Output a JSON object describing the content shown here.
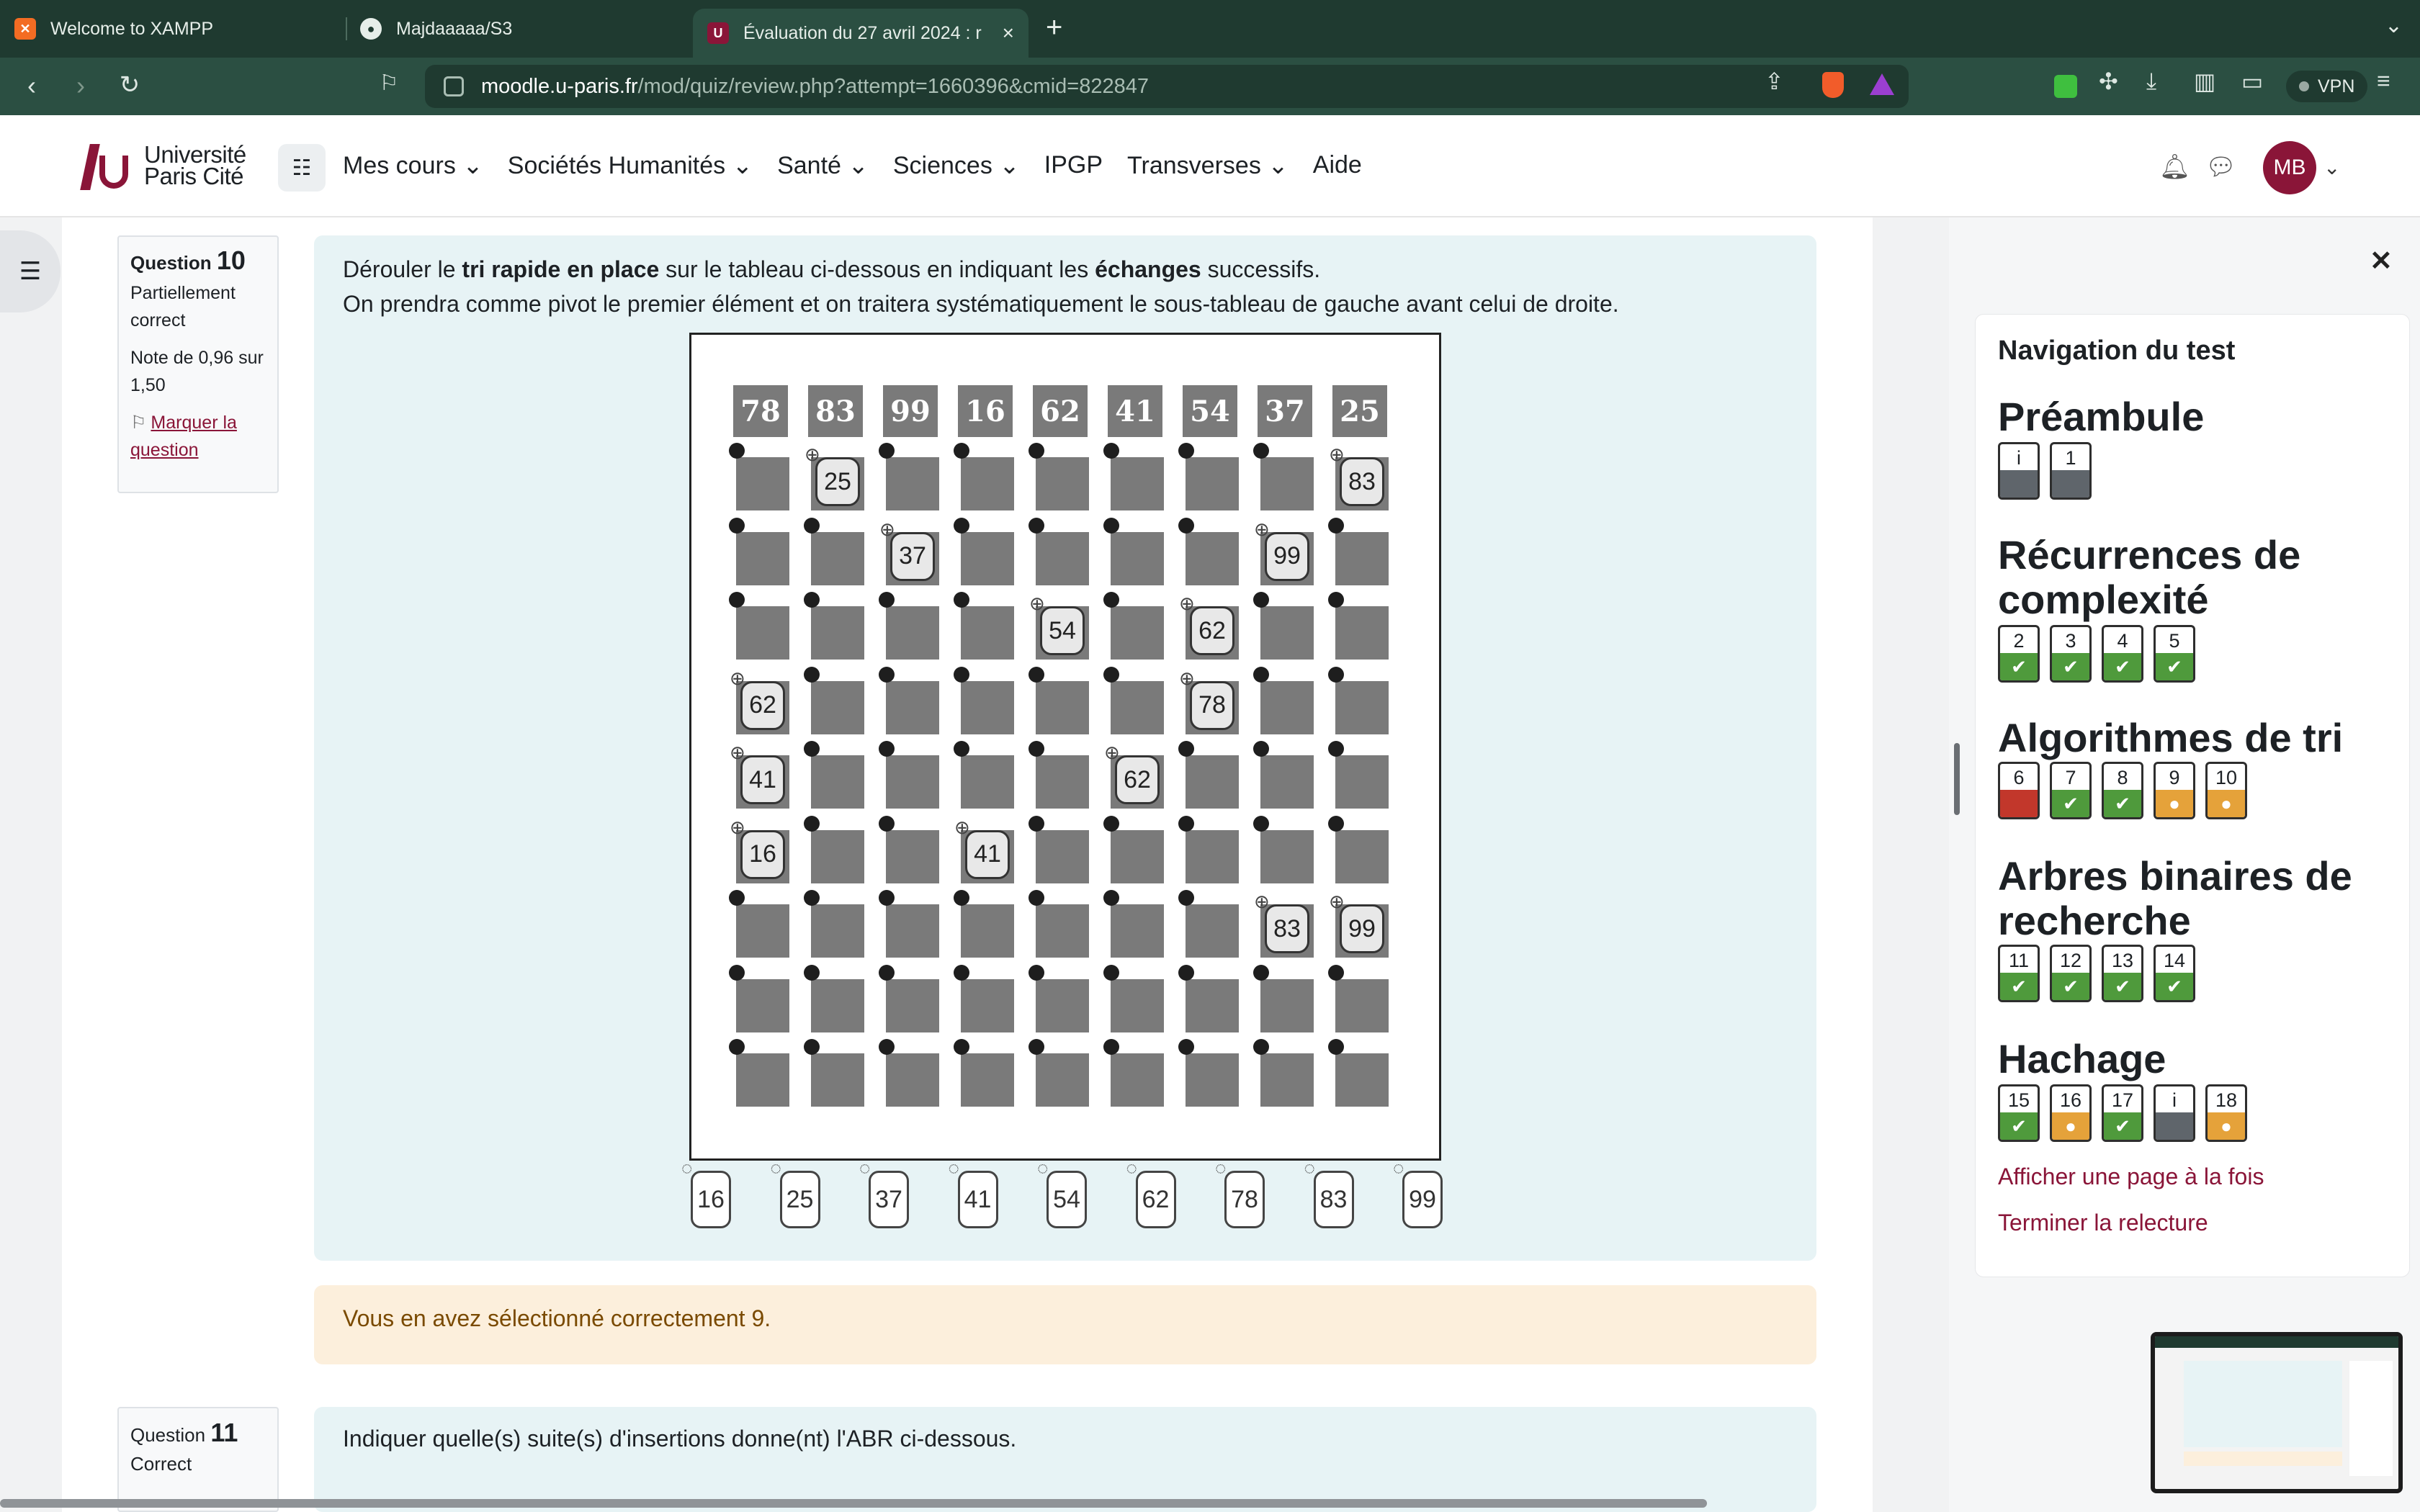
{
  "browser": {
    "tabs": [
      {
        "title": "Welcome to XAMPP",
        "icon": "xampp-icon"
      },
      {
        "title": "Majdaaaaa/S3",
        "icon": "github-icon"
      },
      {
        "title": "Évaluation du 27 avril 2024 : r",
        "icon": "moodle-icon",
        "active": true
      }
    ],
    "url_host": "moodle.u-paris.fr",
    "url_path": "/mod/quiz/review.php?attempt=1660396&cmid=822847",
    "vpn_label": "VPN"
  },
  "site": {
    "logo_line1": "Université",
    "logo_line2": "Paris Cité",
    "menu": [
      "Mes cours",
      "Sociétés Humanités",
      "Santé",
      "Sciences",
      "IPGP",
      "Transverses",
      "Aide"
    ],
    "menu_has_caret": [
      true,
      true,
      true,
      true,
      false,
      true,
      false
    ],
    "user_initials": "MB",
    "brand_color": "#8a1538"
  },
  "question10": {
    "label": "Question",
    "number": "10",
    "state": "Partiellement correct",
    "grade": "Note de 0,96 sur 1,50",
    "flag": "Marquer la question",
    "prompt1_pre": "Dérouler le ",
    "prompt1_b1": "tri rapide en place",
    "prompt1_mid": " sur le tableau ci-dessous en indiquant les ",
    "prompt1_b2": "échanges",
    "prompt1_post": " successifs.",
    "prompt2": "On prendra comme pivot le premier élément et on traitera systématiquement le sous-tableau de gauche avant celui de droite.",
    "header": [
      "78",
      "83",
      "99",
      "16",
      "62",
      "41",
      "54",
      "37",
      "25"
    ],
    "rows": 9,
    "placements": [
      {
        "row": 0,
        "col": 1,
        "value": "25"
      },
      {
        "row": 0,
        "col": 8,
        "value": "83"
      },
      {
        "row": 1,
        "col": 2,
        "value": "37"
      },
      {
        "row": 1,
        "col": 7,
        "value": "99"
      },
      {
        "row": 2,
        "col": 4,
        "value": "54"
      },
      {
        "row": 2,
        "col": 6,
        "value": "62"
      },
      {
        "row": 3,
        "col": 0,
        "value": "62"
      },
      {
        "row": 3,
        "col": 6,
        "value": "78"
      },
      {
        "row": 4,
        "col": 0,
        "value": "41"
      },
      {
        "row": 4,
        "col": 5,
        "value": "62"
      },
      {
        "row": 5,
        "col": 0,
        "value": "16"
      },
      {
        "row": 5,
        "col": 3,
        "value": "41"
      },
      {
        "row": 6,
        "col": 7,
        "value": "83"
      },
      {
        "row": 6,
        "col": 8,
        "value": "99"
      }
    ],
    "choices": [
      "16",
      "25",
      "37",
      "41",
      "54",
      "62",
      "78",
      "83",
      "99"
    ],
    "feedback": "Vous en avez sélectionné correctement 9."
  },
  "question11": {
    "label": "Question",
    "number": "11",
    "state": "Correct",
    "prompt": "Indiquer quelle(s) suite(s) d'insertions donne(nt) l'ABR ci-dessous."
  },
  "quiz_nav": {
    "title": "Navigation du test",
    "sections": [
      {
        "name": "Préambule",
        "buttons": [
          {
            "label": "i",
            "status": "info"
          },
          {
            "label": "1",
            "status": "info"
          }
        ]
      },
      {
        "name": "Récurrences de complexité",
        "buttons": [
          {
            "label": "2",
            "status": "correct"
          },
          {
            "label": "3",
            "status": "correct"
          },
          {
            "label": "4",
            "status": "correct"
          },
          {
            "label": "5",
            "status": "correct"
          }
        ]
      },
      {
        "name": "Algorithmes de tri",
        "buttons": [
          {
            "label": "6",
            "status": "incorrect"
          },
          {
            "label": "7",
            "status": "correct"
          },
          {
            "label": "8",
            "status": "correct"
          },
          {
            "label": "9",
            "status": "partial"
          },
          {
            "label": "10",
            "status": "partial"
          }
        ]
      },
      {
        "name": "Arbres binaires de recherche",
        "buttons": [
          {
            "label": "11",
            "status": "correct"
          },
          {
            "label": "12",
            "status": "correct"
          },
          {
            "label": "13",
            "status": "correct"
          },
          {
            "label": "14",
            "status": "correct"
          }
        ]
      },
      {
        "name": "Hachage",
        "buttons": [
          {
            "label": "15",
            "status": "correct"
          },
          {
            "label": "16",
            "status": "partial"
          },
          {
            "label": "17",
            "status": "correct"
          },
          {
            "label": "i",
            "status": "info"
          },
          {
            "label": "18",
            "status": "partial"
          }
        ]
      }
    ],
    "show_one_page": "Afficher une page à la fois",
    "finish_review": "Terminer la relecture",
    "status_colors": {
      "correct": "#4f9a3c",
      "partial": "#e5a23a",
      "incorrect": "#c2372b",
      "info": "#5f656b"
    }
  }
}
